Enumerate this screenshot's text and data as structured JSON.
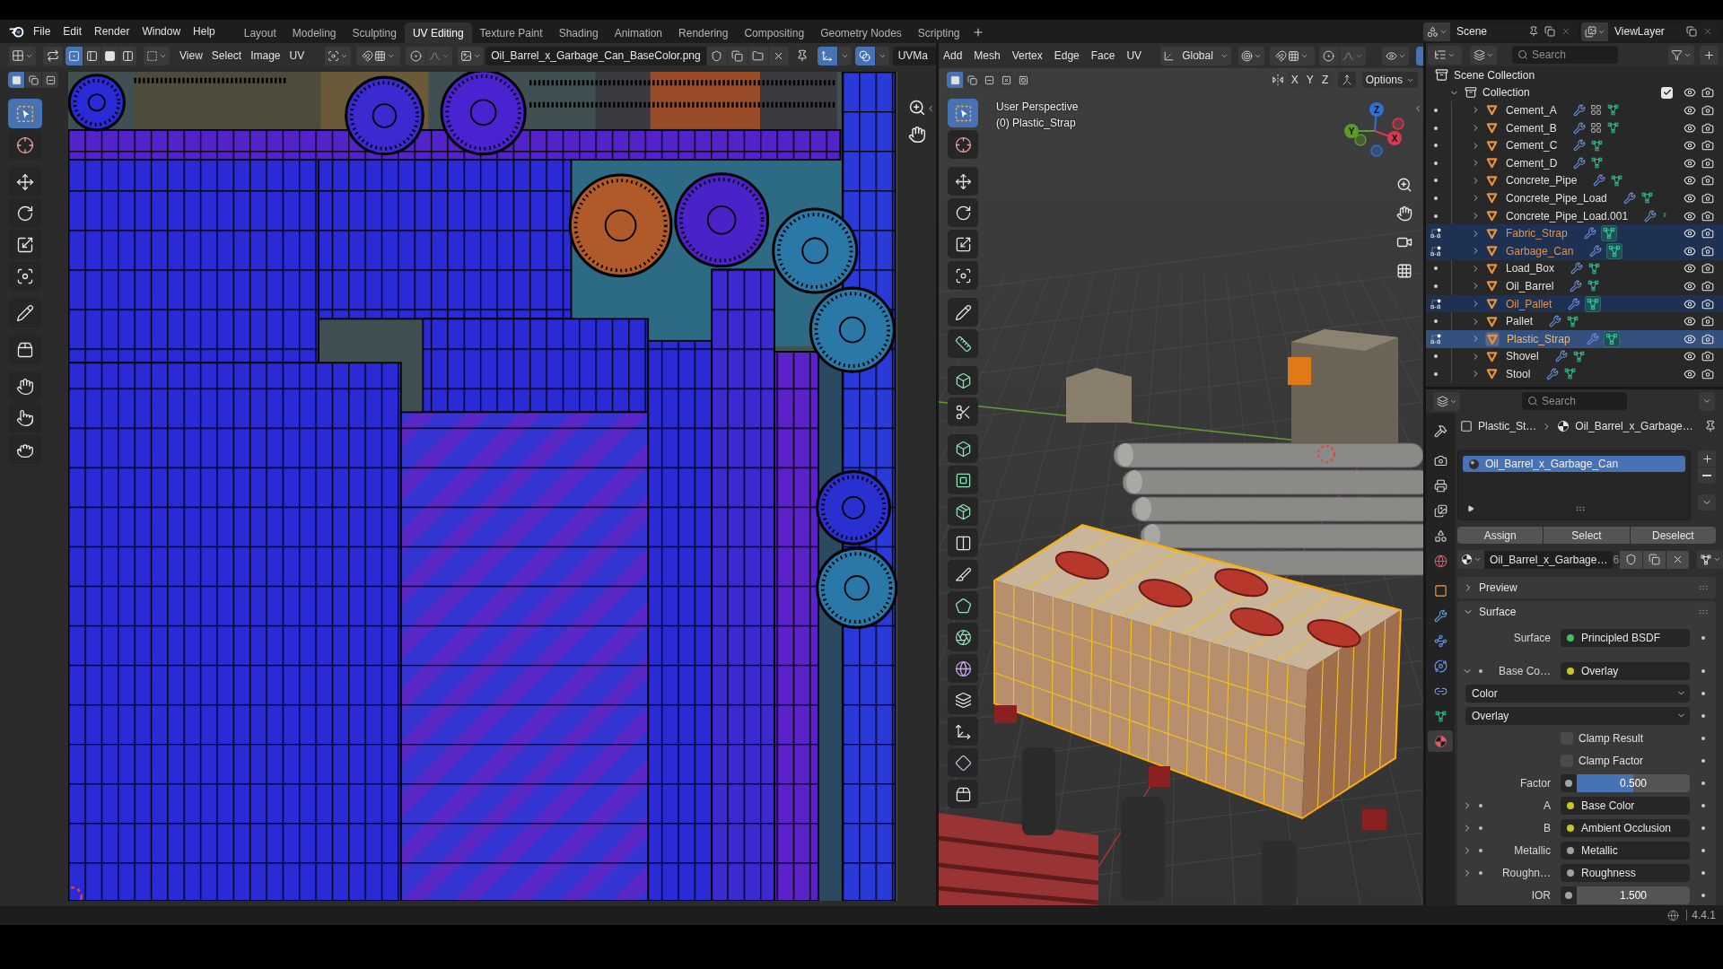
{
  "topbar": {
    "menus": [
      "File",
      "Edit",
      "Render",
      "Window",
      "Help"
    ],
    "workspaces": [
      {
        "label": "Layout",
        "selected": false
      },
      {
        "label": "Modeling",
        "selected": false
      },
      {
        "label": "Sculpting",
        "selected": false
      },
      {
        "label": "UV Editing",
        "selected": true
      },
      {
        "label": "Texture Paint",
        "selected": false
      },
      {
        "label": "Shading",
        "selected": false
      },
      {
        "label": "Animation",
        "selected": false
      },
      {
        "label": "Rendering",
        "selected": false
      },
      {
        "label": "Compositing",
        "selected": false
      },
      {
        "label": "Geometry Nodes",
        "selected": false
      },
      {
        "label": "Scripting",
        "selected": false
      }
    ],
    "scene": "Scene",
    "view_layer": "ViewLayer"
  },
  "uv_editor": {
    "sync_selection": false,
    "select_modes": [
      {
        "kind": "vertex",
        "selected": true
      },
      {
        "kind": "edge",
        "selected": false
      },
      {
        "kind": "face",
        "selected": false
      },
      {
        "kind": "island",
        "selected": false
      }
    ],
    "menus": [
      "View",
      "Select",
      "Image",
      "UV"
    ],
    "image_name": "Oil_Barrel_x_Garbage_Can_BaseColor.png",
    "gizmos": true,
    "overlays": true,
    "uv_map": "UVMa",
    "selection_ops": [
      {
        "kind": "set",
        "selected": true
      },
      {
        "kind": "extend",
        "selected": false
      },
      {
        "kind": "subtract",
        "selected": false
      }
    ],
    "tool_groups": [
      [
        {
          "kind": "select",
          "selected": true
        },
        {
          "kind": "cursor",
          "selected": false
        }
      ],
      [
        {
          "kind": "move",
          "selected": false
        },
        {
          "kind": "rotate",
          "selected": false
        },
        {
          "kind": "scale",
          "selected": false
        },
        {
          "kind": "transform",
          "selected": false
        }
      ],
      [
        {
          "kind": "annotate",
          "selected": false
        }
      ],
      [
        {
          "kind": "rip",
          "selected": false
        }
      ],
      [
        {
          "kind": "grab",
          "selected": false
        },
        {
          "kind": "relax",
          "selected": false
        },
        {
          "kind": "pinch",
          "selected": false
        }
      ]
    ]
  },
  "viewport": {
    "menus": [
      "Add",
      "Mesh",
      "Vertex",
      "Edge",
      "Face",
      "UV"
    ],
    "orientation": "Global",
    "gizmos": true,
    "selection_ops": [
      {
        "kind": "set",
        "selected": true
      },
      {
        "kind": "extend",
        "selected": false
      },
      {
        "kind": "subtract",
        "selected": false
      },
      {
        "kind": "invert",
        "selected": false
      },
      {
        "kind": "intersect",
        "selected": false
      }
    ],
    "mirror_axes": [
      "X",
      "Y",
      "Z"
    ],
    "options": "Options",
    "view_name": "User Perspective",
    "object_label": "(0) Plastic_Strap",
    "gizmo_axes": [
      {
        "label": "Z",
        "color": "#2f6fd6"
      },
      {
        "label": "Y",
        "color": "#5c9c2a"
      },
      {
        "label": "X",
        "color": "#d63a52"
      }
    ],
    "tool_groups": [
      [
        {
          "kind": "select",
          "selected": true
        },
        {
          "kind": "cursor",
          "selected": false
        }
      ],
      [
        {
          "kind": "move",
          "selected": false
        },
        {
          "kind": "rotate",
          "selected": false
        },
        {
          "kind": "scale",
          "selected": false
        },
        {
          "kind": "transform",
          "selected": false
        }
      ],
      [
        {
          "kind": "annotate",
          "selected": false
        },
        {
          "kind": "measure",
          "selected": false
        }
      ],
      [
        {
          "kind": "add",
          "selected": false
        },
        {
          "kind": "project",
          "selected": false
        }
      ],
      [
        {
          "kind": "extrude",
          "selected": false
        },
        {
          "kind": "inset",
          "selected": false
        },
        {
          "kind": "bevel",
          "selected": false
        },
        {
          "kind": "loopcut",
          "selected": false
        },
        {
          "kind": "knife",
          "selected": false
        },
        {
          "kind": "polybuild",
          "selected": false
        },
        {
          "kind": "spin",
          "selected": false
        },
        {
          "kind": "smooth",
          "selected": false
        },
        {
          "kind": "slide",
          "selected": false
        },
        {
          "kind": "shrink",
          "selected": false
        },
        {
          "kind": "shear",
          "selected": false
        },
        {
          "kind": "rip",
          "selected": false
        }
      ]
    ]
  },
  "outliner": {
    "search": {
      "placeholder": "Search"
    },
    "scene_collection": "Scene Collection",
    "collection": {
      "name": "Collection",
      "checked": true,
      "expanded": true
    },
    "objects": [
      {
        "name": "Cement_A",
        "selected": false,
        "active": false,
        "expanded": false,
        "badges": [
          {
            "kind": "modifier"
          },
          {
            "kind": "particles"
          },
          {
            "kind": "mesh"
          }
        ]
      },
      {
        "name": "Cement_B",
        "selected": false,
        "active": false,
        "expanded": false,
        "badges": [
          {
            "kind": "modifier"
          },
          {
            "kind": "particles"
          },
          {
            "kind": "mesh"
          }
        ]
      },
      {
        "name": "Cement_C",
        "selected": false,
        "active": false,
        "expanded": false,
        "badges": [
          {
            "kind": "modifier"
          },
          {
            "kind": "mesh"
          }
        ]
      },
      {
        "name": "Cement_D",
        "selected": false,
        "active": false,
        "expanded": false,
        "badges": [
          {
            "kind": "modifier"
          },
          {
            "kind": "mesh"
          }
        ]
      },
      {
        "name": "Concrete_Pipe",
        "selected": false,
        "active": false,
        "expanded": false,
        "badges": [
          {
            "kind": "modifier"
          },
          {
            "kind": "mesh"
          }
        ]
      },
      {
        "name": "Concrete_Pipe_Load",
        "selected": false,
        "active": false,
        "expanded": false,
        "badges": [
          {
            "kind": "modifier"
          },
          {
            "kind": "mesh"
          }
        ]
      },
      {
        "name": "Concrete_Pipe_Load.001",
        "selected": false,
        "active": false,
        "expanded": false,
        "badges": [
          {
            "kind": "modifier"
          },
          {
            "kind": "stub"
          }
        ]
      },
      {
        "name": "Fabric_Strap",
        "selected": true,
        "active": false,
        "expanded": false,
        "badges": [
          {
            "kind": "modifier"
          },
          {
            "kind": "mesh"
          }
        ]
      },
      {
        "name": "Garbage_Can",
        "selected": true,
        "active": false,
        "expanded": false,
        "badges": [
          {
            "kind": "modifier"
          },
          {
            "kind": "mesh"
          }
        ]
      },
      {
        "name": "Load_Box",
        "selected": false,
        "active": false,
        "expanded": false,
        "badges": [
          {
            "kind": "modifier"
          },
          {
            "kind": "mesh"
          }
        ]
      },
      {
        "name": "Oil_Barrel",
        "selected": false,
        "active": false,
        "expanded": false,
        "badges": [
          {
            "kind": "modifier"
          },
          {
            "kind": "mesh"
          }
        ]
      },
      {
        "name": "Oil_Pallet",
        "selected": true,
        "active": false,
        "expanded": false,
        "badges": [
          {
            "kind": "modifier"
          },
          {
            "kind": "mesh"
          }
        ]
      },
      {
        "name": "Pallet",
        "selected": false,
        "active": false,
        "expanded": false,
        "badges": [
          {
            "kind": "modifier"
          },
          {
            "kind": "mesh"
          }
        ]
      },
      {
        "name": "Plastic_Strap",
        "selected": true,
        "active": true,
        "expanded": false,
        "badges": [
          {
            "kind": "modifier"
          },
          {
            "kind": "mesh"
          }
        ]
      },
      {
        "name": "Shovel",
        "selected": false,
        "active": false,
        "expanded": false,
        "badges": [
          {
            "kind": "modifier"
          },
          {
            "kind": "mesh"
          }
        ]
      },
      {
        "name": "Stool",
        "selected": false,
        "active": false,
        "expanded": false,
        "badges": [
          {
            "kind": "modifier"
          },
          {
            "kind": "mesh"
          }
        ]
      }
    ]
  },
  "properties": {
    "search": {
      "placeholder": "Search"
    },
    "tab_groups": [
      [
        {
          "kind": "tool",
          "selected": false
        }
      ],
      [
        {
          "kind": "render",
          "selected": false
        },
        {
          "kind": "output",
          "selected": false
        },
        {
          "kind": "viewlayer",
          "selected": false
        },
        {
          "kind": "scene",
          "selected": false
        },
        {
          "kind": "world",
          "selected": false
        }
      ],
      [
        {
          "kind": "object",
          "selected": false
        },
        {
          "kind": "modifiers",
          "selected": false
        },
        {
          "kind": "particles",
          "selected": false
        },
        {
          "kind": "physics",
          "selected": false
        },
        {
          "kind": "constraints",
          "selected": false
        },
        {
          "kind": "data",
          "selected": false
        },
        {
          "kind": "material",
          "selected": true
        }
      ]
    ],
    "breadcrumb": [
      "Plastic_St…",
      "Oil_Barrel_x_Garbage…"
    ],
    "slots": [
      {
        "name": "Oil_Barrel_x_Garbage_Can",
        "selected": true
      }
    ],
    "slot_actions": [
      "Assign",
      "Select",
      "Deselect"
    ],
    "material": {
      "name": "Oil_Barrel_x_Garbage…",
      "users": "6"
    },
    "preview": {
      "title": "Preview",
      "expanded": false
    },
    "surface": {
      "title": "Surface",
      "expanded": true,
      "rows": [
        {
          "kind": "socket",
          "label": "Surface",
          "value": "Principled BSDF",
          "color": "#3fbf5f"
        },
        {
          "kind": "input",
          "label": "Base Co…",
          "value": "Overlay",
          "color": "#c7c729",
          "expanded": true
        },
        {
          "kind": "dropdown",
          "value": "Color"
        },
        {
          "kind": "dropdown",
          "value": "Overlay"
        },
        {
          "kind": "checkbox",
          "label": "Clamp Result",
          "checked": false
        },
        {
          "kind": "checkbox",
          "label": "Clamp Factor",
          "checked": false
        },
        {
          "kind": "slider",
          "label": "Factor",
          "value": "0.500",
          "level": 0.5,
          "color": "#a1a1a1"
        },
        {
          "kind": "input",
          "label": "A",
          "value": "Base Color",
          "color": "#c7c729",
          "expanded": false
        },
        {
          "kind": "input",
          "label": "B",
          "value": "Ambient Occlusion",
          "color": "#c7c729",
          "expanded": false
        },
        {
          "kind": "input",
          "label": "Metallic",
          "value": "Metallic",
          "color": "#a1a1a1",
          "expanded": false
        },
        {
          "kind": "input",
          "label": "Roughn…",
          "value": "Roughness",
          "color": "#a1a1a1",
          "expanded": false
        },
        {
          "kind": "number",
          "label": "IOR",
          "value": "1.500",
          "color": "#a1a1a1"
        }
      ]
    }
  },
  "status_bar": {
    "version": "4.4.1"
  }
}
